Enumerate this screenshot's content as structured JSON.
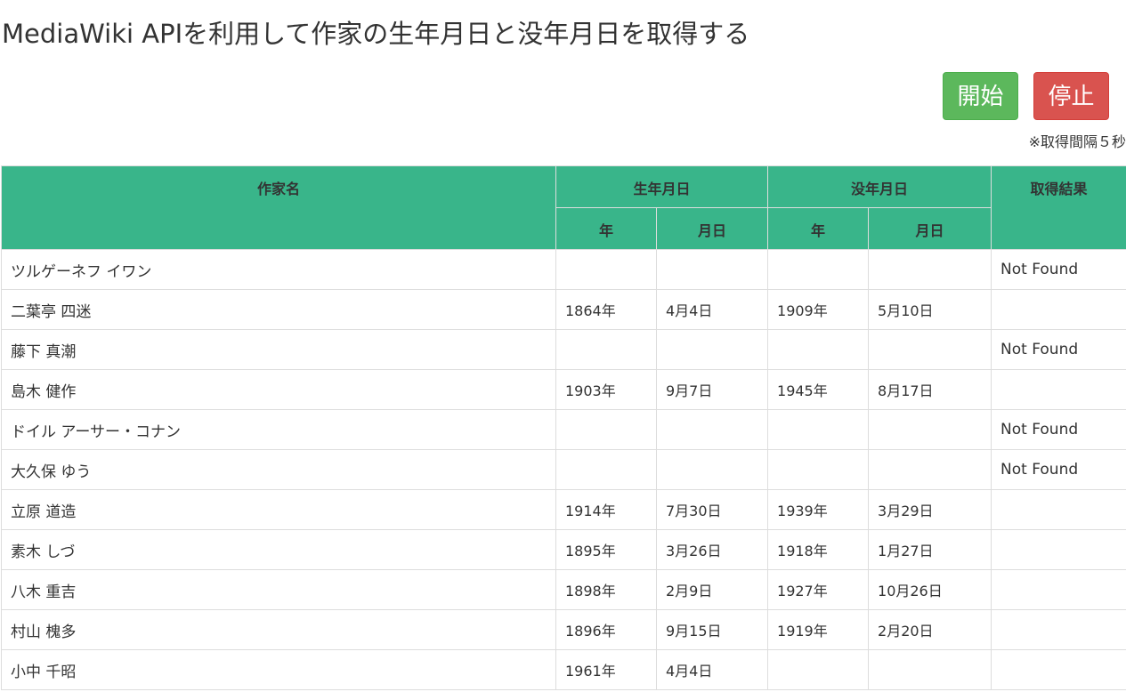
{
  "page": {
    "title": "MediaWiki APIを利用して作家の生年月日と没年月日を取得する"
  },
  "controls": {
    "start_label": "開始",
    "stop_label": "停止",
    "interval_note": "※取得間隔５秒"
  },
  "colors": {
    "header_bg": "#39b58a",
    "start_button": "#5cb85c",
    "stop_button": "#d9534f"
  },
  "table": {
    "headers": {
      "author": "作家名",
      "birth": "生年月日",
      "death": "没年月日",
      "result": "取得結果",
      "birth_year": "年",
      "birth_monthday": "月日",
      "death_year": "年",
      "death_monthday": "月日"
    },
    "rows": [
      {
        "name": "ツルゲーネフ イワン",
        "birth_year": "",
        "birth_md": "",
        "death_year": "",
        "death_md": "",
        "result": "Not Found"
      },
      {
        "name": "二葉亭 四迷",
        "birth_year": "1864年",
        "birth_md": "4月4日",
        "death_year": "1909年",
        "death_md": "5月10日",
        "result": ""
      },
      {
        "name": "藤下 真潮",
        "birth_year": "",
        "birth_md": "",
        "death_year": "",
        "death_md": "",
        "result": "Not Found"
      },
      {
        "name": "島木 健作",
        "birth_year": "1903年",
        "birth_md": "9月7日",
        "death_year": "1945年",
        "death_md": "8月17日",
        "result": ""
      },
      {
        "name": "ドイル アーサー・コナン",
        "birth_year": "",
        "birth_md": "",
        "death_year": "",
        "death_md": "",
        "result": "Not Found"
      },
      {
        "name": "大久保 ゆう",
        "birth_year": "",
        "birth_md": "",
        "death_year": "",
        "death_md": "",
        "result": "Not Found"
      },
      {
        "name": "立原 道造",
        "birth_year": "1914年",
        "birth_md": "7月30日",
        "death_year": "1939年",
        "death_md": "3月29日",
        "result": ""
      },
      {
        "name": "素木 しづ",
        "birth_year": "1895年",
        "birth_md": "3月26日",
        "death_year": "1918年",
        "death_md": "1月27日",
        "result": ""
      },
      {
        "name": "八木 重吉",
        "birth_year": "1898年",
        "birth_md": "2月9日",
        "death_year": "1927年",
        "death_md": "10月26日",
        "result": ""
      },
      {
        "name": "村山 槐多",
        "birth_year": "1896年",
        "birth_md": "9月15日",
        "death_year": "1919年",
        "death_md": "2月20日",
        "result": ""
      },
      {
        "name": "小中 千昭",
        "birth_year": "1961年",
        "birth_md": "4月4日",
        "death_year": "",
        "death_md": "",
        "result": ""
      }
    ]
  }
}
